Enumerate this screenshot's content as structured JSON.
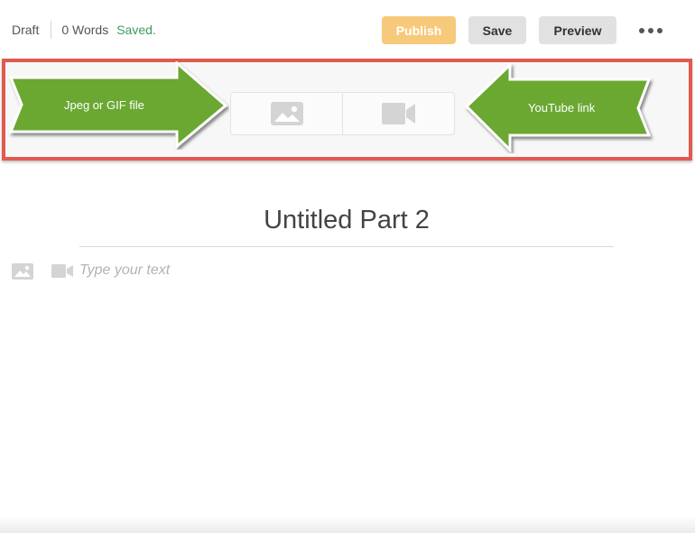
{
  "topbar": {
    "status": "Draft",
    "word_count": "0 Words",
    "save_state": "Saved.",
    "publish_label": "Publish",
    "save_label": "Save",
    "preview_label": "Preview",
    "more_icon": "more-horizontal-icon"
  },
  "media_toolbar": {
    "image_icon": "image-icon",
    "video_icon": "video-camera-icon",
    "callout_left": "Jpeg or GIF file",
    "callout_right": "YouTube link",
    "highlight_color": "#e05a4f",
    "arrow_color": "#6aa830"
  },
  "editor": {
    "title": "Untitled Part 2",
    "body_placeholder": "Type your text"
  },
  "colors": {
    "publish_button": "#f7c97a",
    "secondary_button": "#e1e1e1",
    "saved_text": "#3b9b5e"
  }
}
